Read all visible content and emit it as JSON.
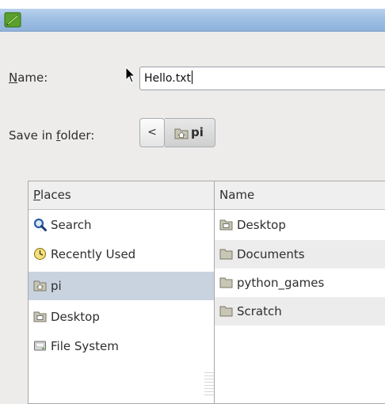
{
  "dialog": {
    "name_label_prefix": "",
    "name_label_u": "N",
    "name_label_rest": "ame:",
    "name_value": "Hello.txt",
    "folder_label_prefix": "Save in ",
    "folder_label_u": "f",
    "folder_label_rest": "older:",
    "back_glyph": "<",
    "current_folder": "pi"
  },
  "places": {
    "header_u": "P",
    "header_rest": "laces",
    "items": [
      {
        "label": "Search",
        "icon": "magnifier-icon"
      },
      {
        "label": "Recently Used",
        "icon": "clock-icon"
      },
      {
        "label": "pi",
        "icon": "home-folder-icon",
        "selected": true
      },
      {
        "label": "Desktop",
        "icon": "desktop-folder-icon"
      },
      {
        "label": "File System",
        "icon": "drive-icon"
      }
    ]
  },
  "files": {
    "header": "Name",
    "items": [
      {
        "label": "Desktop",
        "icon": "desktop-folder-icon"
      },
      {
        "label": "Documents",
        "icon": "folder-icon"
      },
      {
        "label": "python_games",
        "icon": "folder-icon"
      },
      {
        "label": "Scratch",
        "icon": "folder-icon"
      }
    ]
  },
  "colors": {
    "titlebar": "#9fbfe3",
    "selection": "#c9d3e0",
    "folder": "#c8c6b4"
  }
}
